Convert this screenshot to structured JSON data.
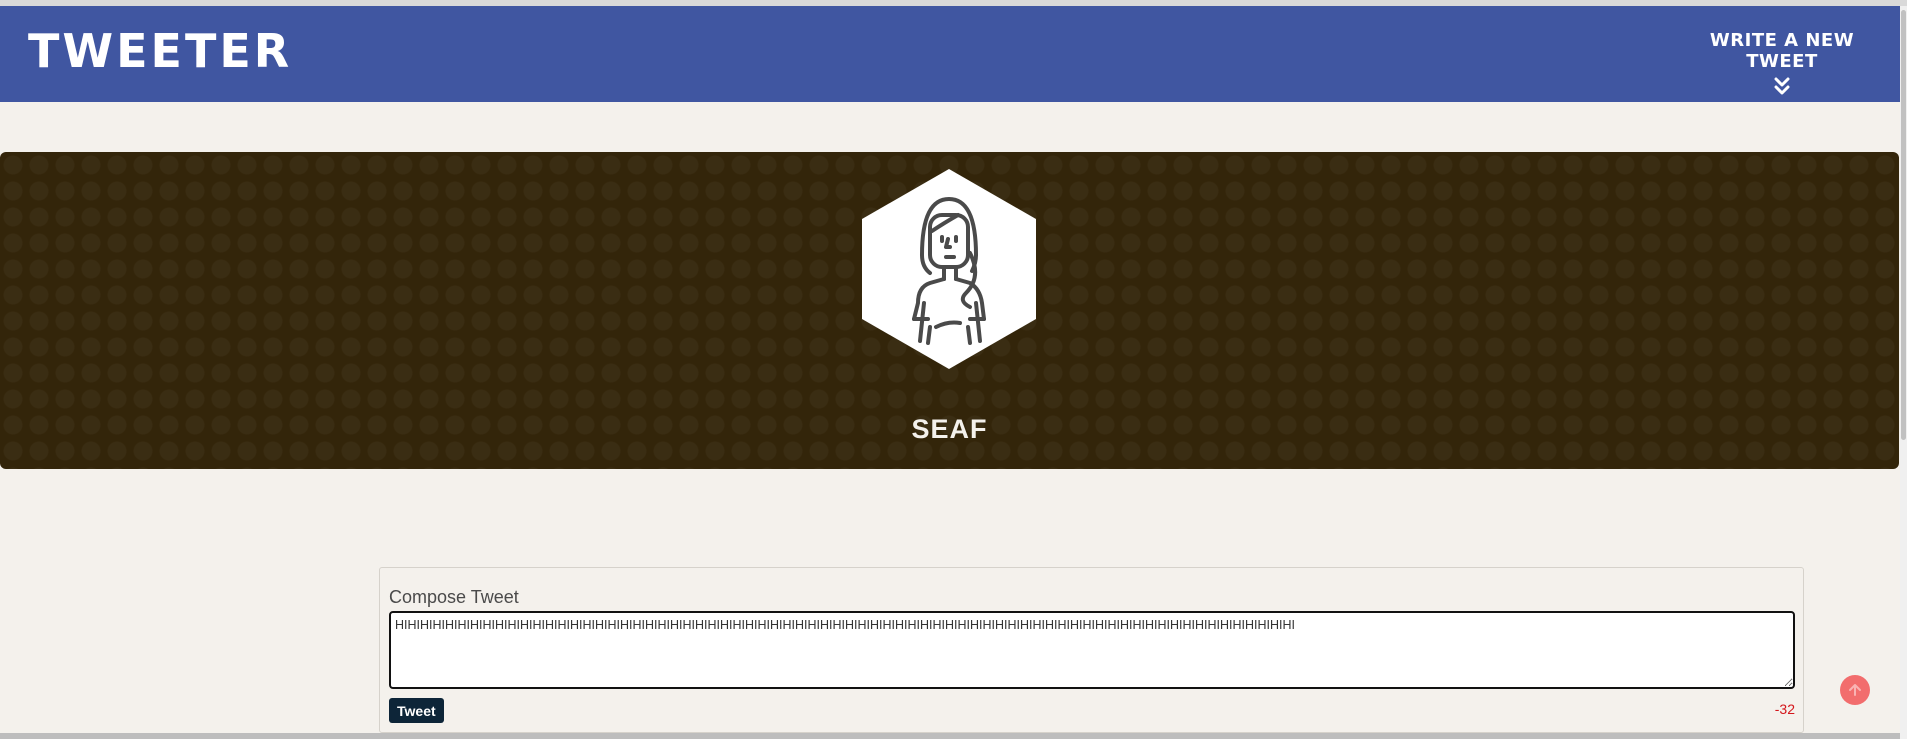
{
  "navbar": {
    "brand": "TWEETER",
    "compose_toggle_label": "WRITE A NEW TWEET",
    "compose_toggle_icon": "double-chevron-down-icon"
  },
  "profile": {
    "name": "SEAF",
    "avatar_icon": "woman-avatar-icon",
    "header_color": "#33250a"
  },
  "compose": {
    "label": "Compose Tweet",
    "textarea_value": "HIHIHIHIHIHIHIHIHIHIHIHIHIHIHIHIHIHIHIHIHIHIHIHIHIHIHIHIHIHIHIHIHIHIHIHIHIHIHIHIHIHIHIHIHIHIHIHIHIHIHIHIHIHIHIHIHIHIHIHIHIHIHIHIHIHIHIHIHIHIHIHI",
    "submit_label": "Tweet",
    "char_counter": "-32"
  },
  "scroll_top": {
    "icon": "arrow-up-icon"
  },
  "colors": {
    "navbar": "#4056a1",
    "background": "#f4f1ec",
    "button": "#0d2538",
    "counter_negative": "#d4161b",
    "scroll_top": "#f26d6d"
  }
}
